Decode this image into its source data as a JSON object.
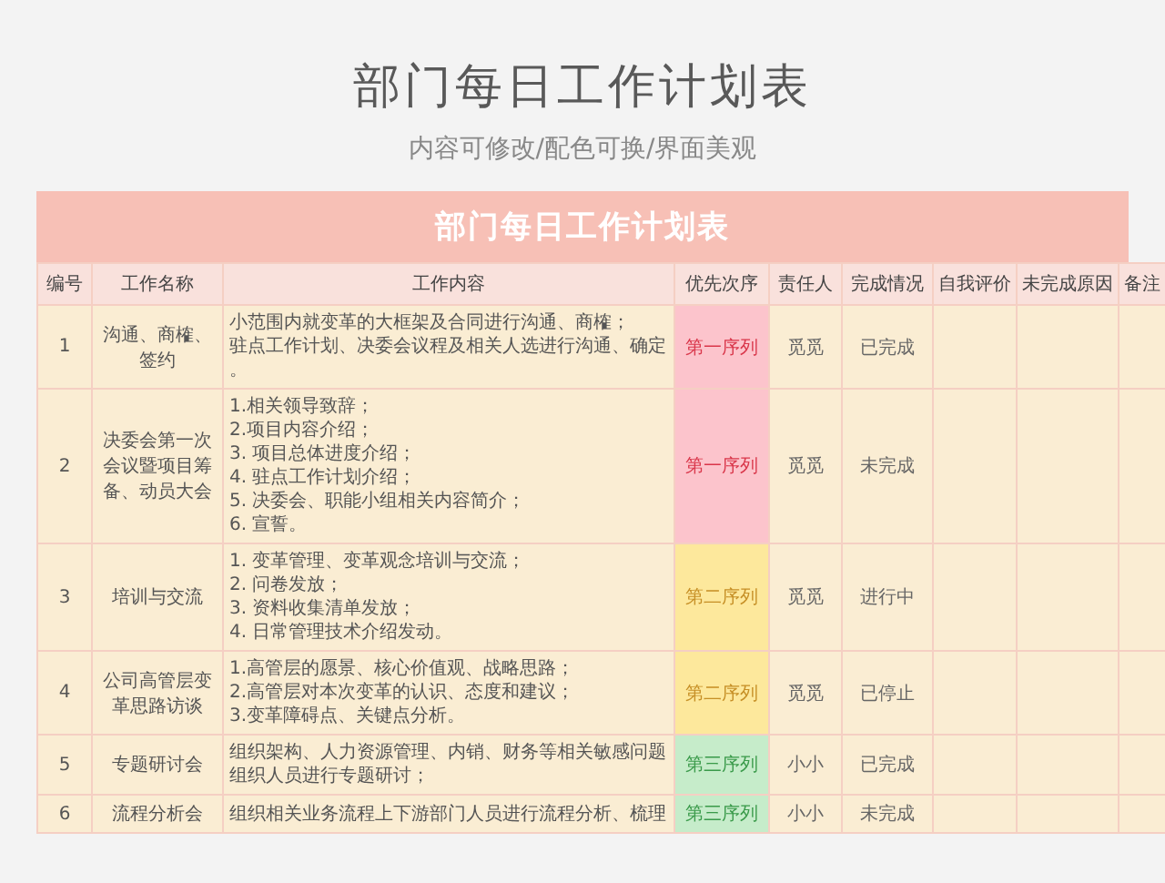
{
  "title": "部门每日工作计划表",
  "subtitle": "内容可修改/配色可换/界面美观",
  "table": {
    "title": "部门每日工作计划表",
    "columns": [
      "编号",
      "工作名称",
      "工作内容",
      "优先次序",
      "责任人",
      "完成情况",
      "自我评价",
      "未完成原因",
      "备注"
    ],
    "rows": [
      {
        "no": "1",
        "name": "沟通、商榷、签约",
        "content": [
          "小范围内就变革的大框架及合同进行沟通、商榷；",
          "驻点工作计划、决委会议程及相关人选进行沟通、确定",
          "。"
        ],
        "priority": {
          "text": "第一序列",
          "kind": "first"
        },
        "owner": "觅觅",
        "status": "已完成"
      },
      {
        "no": "2",
        "name": "决委会第一次会议暨项目筹备、动员大会",
        "content": [
          "1.相关领导致辞；",
          "2.项目内容介绍；",
          "3. 项目总体进度介绍；",
          "4. 驻点工作计划介绍；",
          "5. 决委会、职能小组相关内容简介；",
          "6. 宣誓。"
        ],
        "priority": {
          "text": "第一序列",
          "kind": "first"
        },
        "owner": "觅觅",
        "status": "未完成"
      },
      {
        "no": "3",
        "name": "培训与交流",
        "content": [
          "1. 变革管理、变革观念培训与交流；",
          "2. 问卷发放；",
          "3. 资料收集清单发放；",
          "4. 日常管理技术介绍发动。"
        ],
        "priority": {
          "text": "第二序列",
          "kind": "second"
        },
        "owner": "觅觅",
        "status": "进行中"
      },
      {
        "no": "4",
        "name": "公司高管层变革思路访谈",
        "content": [
          "1.高管层的愿景、核心价值观、战略思路；",
          "2.高管层对本次变革的认识、态度和建议；",
          "3.变革障碍点、关键点分析。"
        ],
        "priority": {
          "text": "第二序列",
          "kind": "second"
        },
        "owner": "觅觅",
        "status": "已停止"
      },
      {
        "no": "5",
        "name": "专题研讨会",
        "content": [
          "组织架构、人力资源管理、内销、财务等相关敏感问题组织人员进行专题研讨；"
        ],
        "priority": {
          "text": "第三序列",
          "kind": "third"
        },
        "owner": "小小",
        "status": "已完成"
      },
      {
        "no": "6",
        "name": "流程分析会",
        "content": [
          "组织相关业务流程上下游部门人员进行流程分析、梳理"
        ],
        "priority": {
          "text": "第三序列",
          "kind": "third"
        },
        "owner": "小小",
        "status": "未完成"
      }
    ]
  }
}
